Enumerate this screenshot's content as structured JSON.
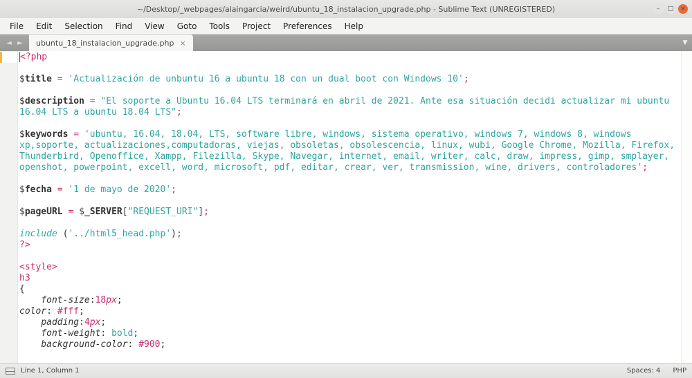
{
  "window": {
    "title": "~/Desktop/_webpages/alaingarcia/weird/ubuntu_18_instalacion_upgrade.php - Sublime Text (UNREGISTERED)"
  },
  "menu": {
    "file": "File",
    "edit": "Edit",
    "selection": "Selection",
    "find": "Find",
    "view": "View",
    "goto": "Goto",
    "tools": "Tools",
    "project": "Project",
    "preferences": "Preferences",
    "help": "Help"
  },
  "tabs": {
    "nav_prev": "◄",
    "nav_next": "►",
    "active": {
      "label": "ubuntu_18_instalacion_upgrade.php",
      "close": "×"
    },
    "more": "▼"
  },
  "code": {
    "l1": "<?php",
    "l3_var": "title",
    "l3_str": "'Actualización de unbuntu 16 a ubuntu 18 con un dual boot con Windows 10'",
    "l5_var": "description",
    "l5_str": "\"El soporte a Ubuntu 16.04 LTS terminará en abril de 2021. Ante esa situación decidi actualizar mi ubuntu 16.04 LTS a ubuntu 18.04 LTS\"",
    "l7_var": "keywords",
    "l7_str": "'ubuntu, 16.04, 18.04, LTS, software libre, windows, sistema operativo, windows 7, windows 8, windows xp,soporte, actualizaciones,computadoras, viejas, obsoletas, obsolescencia, linux, wubi, Google Chrome, Mozilla, Firefox, Thunderbird, Openoffice, Xampp, Filezilla, Skype, Navegar, internet, email, writer, calc, draw, impress, gimp, smplayer, openshot, powerpoint, excell, word, microsoft, pdf, editar, crear, ver, transmission, wine, drivers, controladores'",
    "l9_var": "fecha",
    "l9_str": "'1 de mayo de 2020'",
    "l11_var": "pageURL",
    "l11_var2": "_SERVER",
    "l11_idx": "\"REQUEST_URI\"",
    "l13_func": "include",
    "l13_str": "'../html5_head.php'",
    "l14": "?>",
    "l16_tag": "style",
    "l17": "h3",
    "l18": "{",
    "l19_p": "font-size",
    "l19_n": "18",
    "l19_u": "px",
    "l20_p": "color",
    "l20_v": "#fff",
    "l21_p": "padding",
    "l21_n": "4",
    "l21_u": "px",
    "l22_p": "font-weight",
    "l22_v": "bold",
    "l23_p": "background-color",
    "l23_v": "#900"
  },
  "status": {
    "position": "Line 1, Column 1",
    "spaces": "Spaces: 4",
    "syntax": "PHP"
  }
}
